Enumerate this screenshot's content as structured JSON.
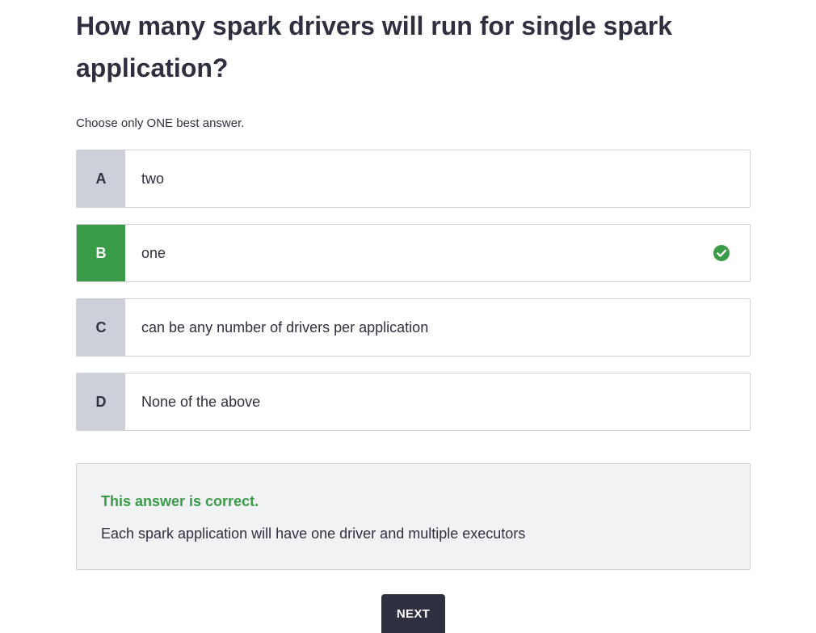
{
  "question": {
    "title": "How many spark drivers will run for single spark application?",
    "instruction": "Choose only ONE best answer."
  },
  "options": [
    {
      "letter": "A",
      "text": "two",
      "correct": false
    },
    {
      "letter": "B",
      "text": "one",
      "correct": true
    },
    {
      "letter": "C",
      "text": "can be any number of drivers per application",
      "correct": false
    },
    {
      "letter": "D",
      "text": "None of the above",
      "correct": false
    }
  ],
  "feedback": {
    "title": "This answer is correct.",
    "explanation": "Each spark application will have one driver and multiple executors"
  },
  "buttons": {
    "next_label": "NEXT"
  },
  "colors": {
    "correct_green": "#3a9b48",
    "letter_gray": "#cdd0d8",
    "text_dark": "#2e3040",
    "feedback_bg": "#f1f2f4"
  },
  "icons": {
    "selected_option": "check-circle-icon"
  }
}
